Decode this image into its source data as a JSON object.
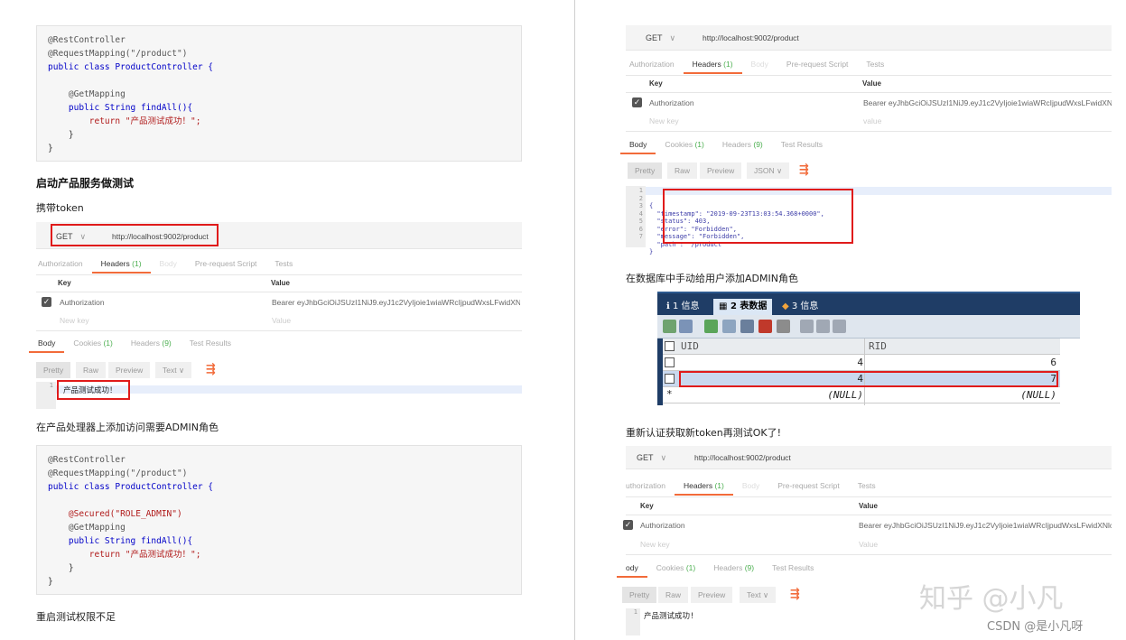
{
  "left": {
    "code1": {
      "lines": [
        "@RestController",
        "@RequestMapping(\"/product\")",
        "public class ProductController {",
        "",
        "    @GetMapping",
        "    public String findAll(){",
        "        return \"产品测试成功！\";",
        "    }",
        "}"
      ]
    },
    "heading": "启动产品服务做测试",
    "para_token": "携带token",
    "postman1": {
      "method": "GET",
      "url": "http://localhost:9002/product",
      "tabs": [
        "Authorization",
        "Headers",
        "(1)",
        "Body",
        "Pre-request Script",
        "Tests"
      ],
      "key_header": "Key",
      "value_header": "Value",
      "row_key": "Authorization",
      "row_value": "Bearer eyJhbGciOiJSUzI1NiJ9.eyJ1c2VyIjoie1wiaWRcIjpudWxsLFwidXNlcm...",
      "new_key": "New key",
      "value_ph": "Value",
      "resp_tabs": [
        "Body",
        "Cookies",
        "(1)",
        "Headers",
        "(9)",
        "Test Results"
      ],
      "fmt_buttons": [
        "Pretty",
        "Raw",
        "Preview"
      ],
      "fmt_select": "Text",
      "line_no": "1",
      "body_text": "产品测试成功！"
    },
    "para_add_role": "在产品处理器上添加访问需要ADMIN角色",
    "code2": {
      "lines": [
        "@RestController",
        "@RequestMapping(\"/product\")",
        "public class ProductController {",
        "",
        "    @Secured(\"ROLE_ADMIN\")",
        "    @GetMapping",
        "    public String findAll(){",
        "        return \"产品测试成功！\";",
        "    }",
        "}"
      ]
    },
    "para_restart": "重启测试权限不足"
  },
  "right": {
    "postman2": {
      "method": "GET",
      "url": "http://localhost:9002/product",
      "tabs": [
        "Authorization",
        "Headers",
        "(1)",
        "Body",
        "Pre-request Script",
        "Tests"
      ],
      "key_header": "Key",
      "value_header": "Value",
      "row_key": "Authorization",
      "row_value": "Bearer eyJhbGciOiJSUzI1NiJ9.eyJ1c2VyIjoie1wiaWRcIjpudWxsLFwidXNlcm...",
      "new_key": "New key",
      "value_ph": "value",
      "resp_tabs": [
        "Body",
        "Cookies",
        "(1)",
        "Headers",
        "(9)",
        "Test Results"
      ],
      "fmt_buttons": [
        "Pretty",
        "Raw",
        "Preview"
      ],
      "fmt_select": "JSON",
      "line_nos": [
        "1",
        "2",
        "3",
        "4",
        "5",
        "6",
        "7"
      ],
      "json_lines": [
        "{",
        "  \"timestamp\": \"2019-09-23T13:03:54.368+0000\",",
        "  \"status\": 403,",
        "  \"error\": \"Forbidden\",",
        "  \"message\": \"Forbidden\",",
        "  \"path\": \"/product\"",
        "}"
      ]
    },
    "para_db": "在数据库中手动给用户添加ADMIN角色",
    "db": {
      "tabs": [
        "1 信息",
        "2 表数据",
        "3 信息"
      ],
      "col1": "UID",
      "col2": "RID",
      "rows": [
        {
          "uid": "4",
          "rid": "6"
        },
        {
          "uid": "4",
          "rid": "7"
        }
      ],
      "null_marker": "*",
      "null_text": "(NULL)"
    },
    "para_retest": "重新认证获取新token再测试OK了!",
    "postman3": {
      "method": "GET",
      "url": "http://localhost:9002/product",
      "tabs": [
        "uthorization",
        "Headers",
        "(1)",
        "Body",
        "Pre-request Script",
        "Tests"
      ],
      "key_header": "Key",
      "value_header": "Value",
      "row_key": "Authorization",
      "row_value": "Bearer eyJhbGciOiJSUzI1NiJ9.eyJ1c2VyIjoie1wiaWRcIjpudWxsLFwidXNlcm...",
      "new_key": "New key",
      "value_ph": "Value",
      "resp_tabs": [
        "ody",
        "Cookies",
        "(1)",
        "Headers",
        "(9)",
        "Test Results"
      ],
      "fmt_buttons": [
        "Pretty",
        "Raw",
        "Preview"
      ],
      "fmt_select": "Text",
      "line_no": "1",
      "body_text": "产品测试成功!"
    }
  },
  "watermark": {
    "zhihu": "知乎 @小凡",
    "csdn": "CSDN @是小凡呀"
  },
  "colors": {
    "accent_tab": "#f26b3a",
    "count_green": "#4caf50",
    "highlight_red": "#e01b1b",
    "db_header": "#1f3d66"
  }
}
